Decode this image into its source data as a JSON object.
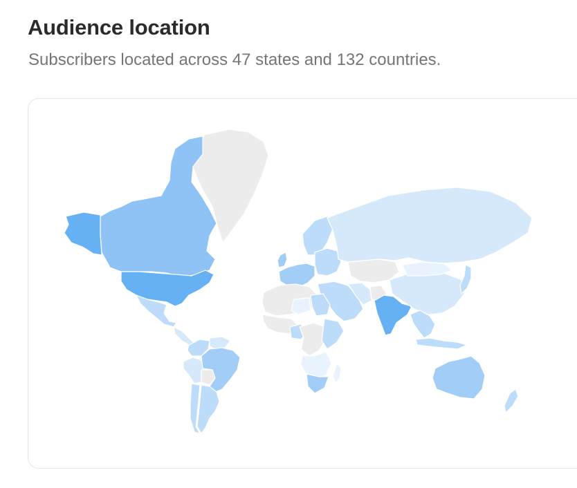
{
  "header": {
    "title": "Audience location",
    "subtitle": "Subscribers located across 47 states and 132 countries."
  },
  "map": {
    "type": "choropleth-world",
    "color_scale": {
      "no_data": "#ececec",
      "lowest": "#e9f3fd",
      "low": "#d6e9fb",
      "medium": "#bcdcf9",
      "high": "#a2cdf7",
      "higher": "#8fc2f5",
      "highest": "#66b0f4"
    },
    "regions": [
      {
        "name": "Greenland",
        "level": "no_data"
      },
      {
        "name": "Canada",
        "level": "higher"
      },
      {
        "name": "Alaska",
        "level": "highest"
      },
      {
        "name": "United States",
        "level": "highest"
      },
      {
        "name": "Mexico",
        "level": "medium"
      },
      {
        "name": "Central America",
        "level": "low"
      },
      {
        "name": "Colombia",
        "level": "medium"
      },
      {
        "name": "Venezuela",
        "level": "low"
      },
      {
        "name": "Peru",
        "level": "low"
      },
      {
        "name": "Bolivia",
        "level": "no_data"
      },
      {
        "name": "Brazil",
        "level": "high"
      },
      {
        "name": "Argentina",
        "level": "medium"
      },
      {
        "name": "Chile",
        "level": "medium"
      },
      {
        "name": "United Kingdom",
        "level": "high"
      },
      {
        "name": "Scandinavia",
        "level": "medium"
      },
      {
        "name": "Western Europe",
        "level": "high"
      },
      {
        "name": "Eastern Europe",
        "level": "medium"
      },
      {
        "name": "Russia",
        "level": "low"
      },
      {
        "name": "Kazakhstan",
        "level": "no_data"
      },
      {
        "name": "Middle East",
        "level": "medium"
      },
      {
        "name": "Iran",
        "level": "low"
      },
      {
        "name": "Afghanistan",
        "level": "no_data"
      },
      {
        "name": "India",
        "level": "highest"
      },
      {
        "name": "China",
        "level": "low"
      },
      {
        "name": "Mongolia",
        "level": "lowest"
      },
      {
        "name": "Southeast Asia",
        "level": "medium"
      },
      {
        "name": "Japan",
        "level": "medium"
      },
      {
        "name": "Indonesia",
        "level": "medium"
      },
      {
        "name": "Australia",
        "level": "high"
      },
      {
        "name": "New Zealand",
        "level": "medium"
      },
      {
        "name": "North Africa",
        "level": "no_data"
      },
      {
        "name": "Egypt",
        "level": "medium"
      },
      {
        "name": "Libya",
        "level": "lowest"
      },
      {
        "name": "West Africa",
        "level": "no_data"
      },
      {
        "name": "Nigeria",
        "level": "medium"
      },
      {
        "name": "Central Africa",
        "level": "no_data"
      },
      {
        "name": "East Africa",
        "level": "medium"
      },
      {
        "name": "Southern Africa",
        "level": "lowest"
      },
      {
        "name": "South Africa",
        "level": "high"
      },
      {
        "name": "Madagascar",
        "level": "lowest"
      }
    ]
  }
}
